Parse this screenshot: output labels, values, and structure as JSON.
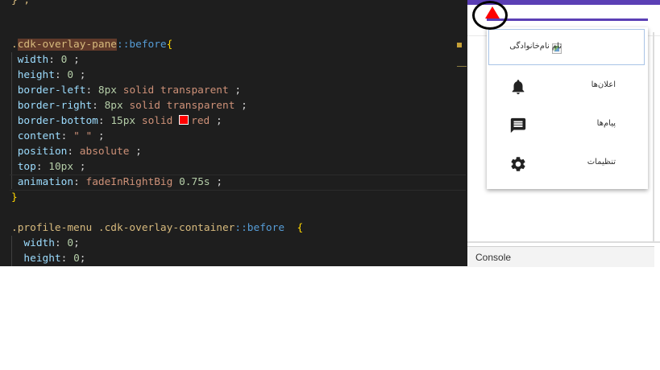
{
  "editor": {
    "prev_fragment": "} ;",
    "block1": {
      "selector": "cdk-overlay-pane",
      "pseudo": "::before",
      "declarations": [
        {
          "prop": "width",
          "value": "0",
          "kind": "num"
        },
        {
          "prop": "height",
          "value": "0",
          "kind": "num"
        },
        {
          "prop": "border-left",
          "num": "8px",
          "rest": "solid transparent"
        },
        {
          "prop": "border-right",
          "num": "8px",
          "rest": "solid transparent"
        },
        {
          "prop": "border-bottom",
          "num": "15px",
          "rest": "solid",
          "color_name": "red",
          "color_hex": "#ff0000"
        },
        {
          "prop": "content",
          "value": "\" \"",
          "kind": "val"
        },
        {
          "prop": "position",
          "value": "absolute",
          "kind": "val"
        },
        {
          "prop": "top",
          "value": "10px",
          "kind": "num"
        },
        {
          "prop": "animation",
          "value": "fadeInRightBig",
          "num": "0.75s"
        }
      ]
    },
    "block2": {
      "selector_a": ".profile-menu",
      "selector_b": ".cdk-overlay-container",
      "pseudo": "::before",
      "declarations": [
        {
          "prop": "width",
          "value": "0"
        },
        {
          "prop": "height",
          "value": "0"
        }
      ]
    }
  },
  "preview": {
    "menu": {
      "header_text": "نام نام‌خانوادگی",
      "items": [
        {
          "label": "اعلان‌ها",
          "icon": "bell-icon"
        },
        {
          "label": "پیام‌ها",
          "icon": "message-icon"
        },
        {
          "label": "تنظیمات",
          "icon": "gear-icon"
        }
      ]
    },
    "console_label": "Console"
  },
  "colors": {
    "accent_purple": "#5b3fb5",
    "triangle_red": "#ff0000",
    "editor_bg": "#1e1e1e"
  }
}
